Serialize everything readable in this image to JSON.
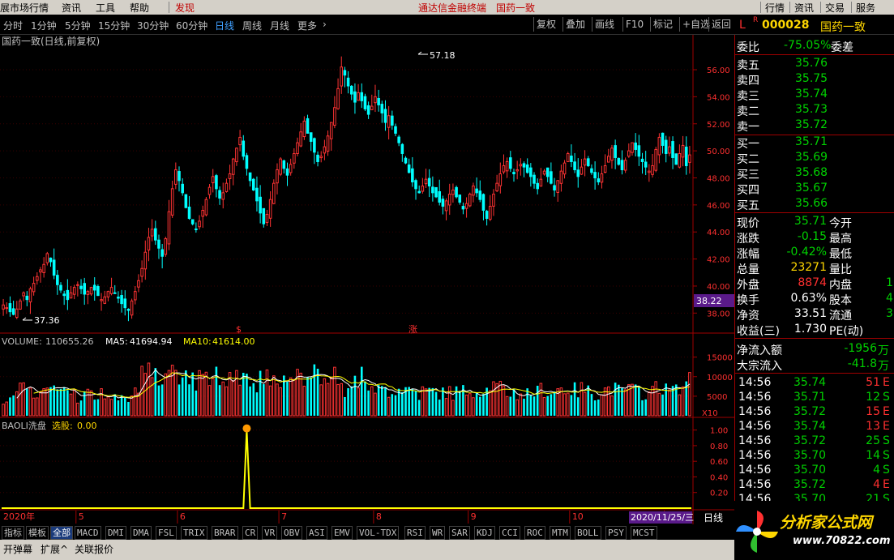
{
  "menu": {
    "items": [
      "展市场行情",
      "资讯",
      "工具",
      "帮助"
    ],
    "discover": "发现",
    "center_title": "通达信金融终端",
    "center_stock": "国药一致",
    "right_items": [
      "行情",
      "资讯",
      "交易",
      "服务"
    ]
  },
  "periods": [
    "分时",
    "1分钟",
    "5分钟",
    "15分钟",
    "30分钟",
    "60分钟",
    "日线",
    "周线",
    "月线",
    "更多"
  ],
  "active_period": "日线",
  "toolbar": [
    "复权",
    "叠加",
    "画线",
    "F10",
    "标记",
    "+自选",
    "返回"
  ],
  "chart_data": [
    {
      "type": "candlestick",
      "title": "国药一致(日线,前复权)",
      "y_ticks": [
        "56.00",
        "54.00",
        "52.00",
        "50.00",
        "48.00",
        "46.00",
        "44.00",
        "42.00",
        "40.00",
        "38.00"
      ],
      "ylim": [
        37,
        57.5
      ],
      "high_label": "57.18",
      "low_label": "37.36",
      "current_price_tag": "38.22",
      "markers": [
        "$",
        "涨"
      ],
      "closes": [
        38.6,
        38.4,
        38.1,
        37.9,
        38.3,
        38.9,
        39.5,
        39.0,
        39.8,
        40.2,
        40.7,
        41.2,
        41.6,
        42.4,
        41.8,
        40.8,
        40.1,
        39.7,
        39.3,
        39.0,
        39.5,
        39.9,
        40.1,
        39.8,
        39.4,
        39.6,
        39.9,
        39.7,
        39.3,
        39.0,
        39.2,
        39.6,
        39.9,
        39.5,
        39.1,
        38.7,
        38.4,
        38.2,
        38.9,
        39.6,
        40.4,
        41.3,
        42.5,
        43.6,
        44.2,
        43.4,
        42.8,
        42.2,
        43.5,
        45.5,
        47.2,
        48.6,
        47.8,
        46.9,
        45.8,
        45.0,
        44.6,
        44.2,
        44.8,
        45.6,
        46.4,
        47.3,
        48.1,
        47.2,
        46.5,
        46.9,
        47.6,
        48.3,
        49.4,
        50.2,
        51.0,
        49.6,
        48.7,
        47.8,
        47.1,
        46.3,
        45.4,
        44.6,
        45.3,
        46.4,
        47.6,
        48.6,
        49.4,
        48.7,
        48.2,
        49.0,
        49.8,
        50.6,
        51.4,
        52.2,
        51.3,
        50.7,
        49.9,
        49.2,
        49.6,
        50.3,
        51.1,
        52.1,
        53.2,
        54.6,
        56.2,
        55.6,
        54.8,
        54.2,
        53.6,
        54.3,
        53.7,
        53.1,
        52.7,
        53.3,
        54.0,
        53.4,
        52.8,
        52.1,
        52.6,
        51.9,
        51.3,
        50.6,
        49.8,
        49.1,
        48.4,
        47.7,
        47.2,
        46.9,
        47.4,
        47.9,
        47.4,
        46.9,
        46.6,
        46.2,
        45.9,
        46.3,
        46.8,
        47.1,
        46.6,
        46.2,
        45.7,
        46.1,
        46.8,
        47.4,
        46.9,
        46.4,
        45.6,
        45.0,
        45.9,
        46.8,
        47.6,
        48.3,
        48.9,
        49.2,
        48.7,
        48.3,
        48.6,
        49.0,
        48.8,
        48.4,
        48.1,
        47.6,
        47.2,
        47.9,
        48.5,
        48.1,
        47.6,
        47.1,
        47.8,
        48.5,
        49.1,
        49.8,
        49.2,
        48.6,
        48.1,
        48.8,
        49.4,
        48.9,
        48.4,
        48.0,
        47.7,
        48.3,
        48.9,
        49.6,
        50.2,
        49.5,
        49.0,
        48.6,
        49.3,
        50.0,
        50.6,
        50.1,
        49.6,
        49.2,
        48.8,
        48.5,
        48.9,
        50.1,
        51.0,
        50.4,
        49.8,
        50.3,
        49.5,
        49.0,
        49.8,
        50.4,
        48.9,
        49.7
      ]
    },
    {
      "type": "bar",
      "title_label": "VOLUME:",
      "title_value": "110655.26",
      "ma5_label": "MA5:",
      "ma5_value": "41694.94",
      "ma10_label": "MA10:",
      "ma10_value": "41614.00",
      "y_ticks": [
        "15000",
        "10000",
        "5000"
      ],
      "unit": "X10",
      "ylim": [
        0,
        17000
      ]
    },
    {
      "type": "line",
      "title_label": "BAOLI洗盘",
      "pick_label": "选股:",
      "pick_value": "0.00",
      "y_ticks": [
        "1.00",
        "0.80",
        "0.60",
        "0.40",
        "0.20"
      ],
      "ylim": [
        0,
        1.1
      ],
      "spike_index": 72
    }
  ],
  "timeline": {
    "year": "2020年",
    "months": [
      "5",
      "6",
      "7",
      "8",
      "9",
      "10",
      "1"
    ],
    "date_tag": "2020/11/25/三",
    "period_tag": "日线"
  },
  "panel": {
    "code_prefix": "L",
    "code_badge": "R",
    "code": "000028",
    "name": "国药一致",
    "weibi_label": "委比",
    "weibi_value": "-75.05%",
    "weicha_label": "委差",
    "asks": [
      {
        "label": "卖五",
        "price": "35.76"
      },
      {
        "label": "卖四",
        "price": "35.75"
      },
      {
        "label": "卖三",
        "price": "35.74"
      },
      {
        "label": "卖二",
        "price": "35.73"
      },
      {
        "label": "卖一",
        "price": "35.72"
      }
    ],
    "bids": [
      {
        "label": "买一",
        "price": "35.71"
      },
      {
        "label": "买二",
        "price": "35.69"
      },
      {
        "label": "买三",
        "price": "35.68"
      },
      {
        "label": "买四",
        "price": "35.67"
      },
      {
        "label": "买五",
        "price": "35.66"
      }
    ],
    "stats": [
      {
        "l": "现价",
        "v": "35.71",
        "l2": "今开",
        "v2": "",
        "c": "#00d000"
      },
      {
        "l": "涨跌",
        "v": "-0.15",
        "l2": "最高",
        "v2": "",
        "c": "#00d000"
      },
      {
        "l": "涨幅",
        "v": "-0.42%",
        "l2": "最低",
        "v2": "",
        "c": "#00d000"
      },
      {
        "l": "总量",
        "v": "23271",
        "l2": "量比",
        "v2": "",
        "c": "#ffd700"
      },
      {
        "l": "外盘",
        "v": "8874",
        "l2": "内盘",
        "v2": "1",
        "c": "#ff3030"
      },
      {
        "l": "换手",
        "v": "0.63%",
        "l2": "股本",
        "v2": "4",
        "c": "#ffffff"
      },
      {
        "l": "净资",
        "v": "33.51",
        "l2": "流通",
        "v2": "3",
        "c": "#ffffff"
      },
      {
        "l": "收益(三)",
        "v": "1.730",
        "l2": "PE(动)",
        "v2": "",
        "c": "#ffffff"
      }
    ],
    "flows": [
      {
        "l": "净流入额",
        "v": "-1956",
        "u": "万"
      },
      {
        "l": "大宗流入",
        "v": "-41.8",
        "u": "万"
      }
    ],
    "ticks": [
      {
        "t": "14:56",
        "p": "35.74",
        "v": "51",
        "f": "E",
        "c": "#ff3030"
      },
      {
        "t": "14:56",
        "p": "35.71",
        "v": "12",
        "f": "S",
        "c": "#00d000"
      },
      {
        "t": "14:56",
        "p": "35.72",
        "v": "15",
        "f": "E",
        "c": "#ff3030"
      },
      {
        "t": "14:56",
        "p": "35.74",
        "v": "13",
        "f": "E",
        "c": "#ff3030"
      },
      {
        "t": "14:56",
        "p": "35.72",
        "v": "25",
        "f": "S",
        "c": "#00d000"
      },
      {
        "t": "14:56",
        "p": "35.70",
        "v": "14",
        "f": "S",
        "c": "#00d000"
      },
      {
        "t": "14:56",
        "p": "35.70",
        "v": "4",
        "f": "S",
        "c": "#00d000"
      },
      {
        "t": "14:56",
        "p": "35.72",
        "v": "4",
        "f": "E",
        "c": "#ff3030"
      },
      {
        "t": "14:56",
        "p": "35.70",
        "v": "21",
        "f": "S",
        "c": "#00d000"
      }
    ]
  },
  "tabs": [
    "指标",
    "模板",
    "全部",
    "MACD",
    "DMI",
    "DMA",
    "FSL",
    "TRIX",
    "BRAR",
    "CR",
    "VR",
    "OBV",
    "ASI",
    "EMV",
    "VOL-TDX",
    "RSI",
    "WR",
    "SAR",
    "KDJ",
    "CCI",
    "ROC",
    "MTM",
    "BOLL",
    "PSY",
    "MCST"
  ],
  "status": [
    "开弹幕",
    "扩展^",
    "关联报价"
  ],
  "logo": {
    "name": "分析家公式网",
    "url": "www.70822.com"
  },
  "colors": {
    "up": "#ff3333",
    "down": "#00ffff",
    "ma5": "#ffffff",
    "ma10": "#ffff00",
    "grid": "#a00000",
    "accent": "#ffd700"
  }
}
